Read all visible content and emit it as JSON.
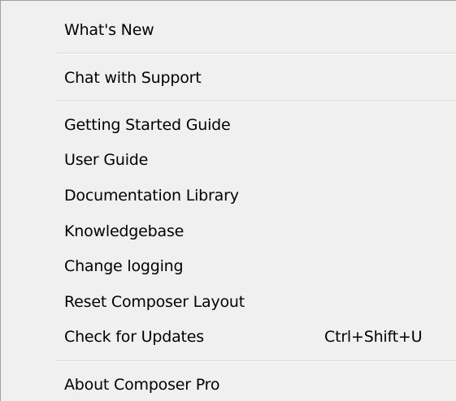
{
  "menu": {
    "items": [
      {
        "label": "What's New",
        "shortcut": ""
      },
      {
        "label": "Chat with Support",
        "shortcut": ""
      },
      {
        "label": "Getting Started Guide",
        "shortcut": ""
      },
      {
        "label": "User Guide",
        "shortcut": ""
      },
      {
        "label": "Documentation Library",
        "shortcut": ""
      },
      {
        "label": "Knowledgebase",
        "shortcut": ""
      },
      {
        "label": "Change logging",
        "shortcut": ""
      },
      {
        "label": "Reset Composer Layout",
        "shortcut": ""
      },
      {
        "label": "Check for Updates",
        "shortcut": "Ctrl+Shift+U"
      },
      {
        "label": "About Composer Pro",
        "shortcut": ""
      }
    ]
  }
}
